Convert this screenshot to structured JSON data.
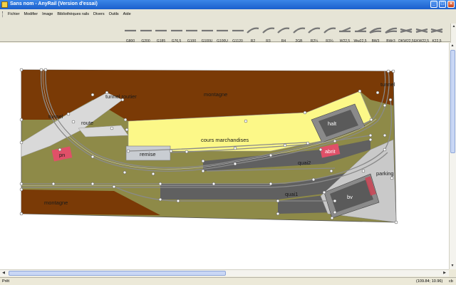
{
  "window": {
    "title": "Sans nom - AnyRail (Version d'essai)",
    "controls": {
      "minimize": "_",
      "maximize": "□",
      "close": "×"
    }
  },
  "menu": [
    "Fichier",
    "Modifier",
    "Image",
    "Bibliothèques rails",
    "Divers",
    "Outils",
    "Aide"
  ],
  "rails": [
    {
      "label": "G800",
      "icon": "straight-track-icon"
    },
    {
      "label": "G200",
      "icon": "straight-track-icon"
    },
    {
      "label": "G185",
      "icon": "straight-track-icon"
    },
    {
      "label": "G76,5",
      "icon": "straight-track-icon"
    },
    {
      "label": "G100",
      "icon": "straight-track-icon"
    },
    {
      "label": "G100U",
      "icon": "straight-track-icon"
    },
    {
      "label": "G100U",
      "icon": "straight-track-icon"
    },
    {
      "label": "G1120",
      "icon": "straight-track-icon"
    },
    {
      "label": "R2",
      "icon": "curved-track-icon"
    },
    {
      "label": "R3",
      "icon": "curved-track-icon"
    },
    {
      "label": "R4",
      "icon": "curved-track-icon"
    },
    {
      "label": "2GB",
      "icon": "curved-track-icon"
    },
    {
      "label": "R2¼",
      "icon": "curved-track-icon"
    },
    {
      "label": "R3¼",
      "icon": "curved-track-icon"
    },
    {
      "label": "W22,5",
      "icon": "switch-icon"
    },
    {
      "label": "Ww22,5",
      "icon": "switch-icon"
    },
    {
      "label": "BW3",
      "icon": "curved-switch-icon"
    },
    {
      "label": "BWr3",
      "icon": "curved-switch-icon"
    },
    {
      "label": "DKW22,5",
      "icon": "crossing-icon"
    },
    {
      "label": "EKW22,5",
      "icon": "crossing-icon"
    },
    {
      "label": "K22,5",
      "icon": "crossing-icon"
    }
  ],
  "layout_labels": {
    "mountain_top": "montagne",
    "mountain_bottom": "montagne",
    "tunnel_left": "tunnel",
    "tunnel_right": "tunnel",
    "road_tunnel": "tunnel routier",
    "road": "route",
    "freight_yard": "cours marchandises",
    "shed": "remise",
    "hall": "halt",
    "shelter": "abrit",
    "platform2": "quai2",
    "platform1": "quai1",
    "parking": "parking",
    "station_building": "bv",
    "crossing_keeper": "pn"
  },
  "colors": {
    "mountain": "#7a3a06",
    "terrain": "#8e8a48",
    "road": "#d9d9d9",
    "freight_yard": "#fcf888",
    "platform": "#606060",
    "building_pink": "#e05068",
    "title_bar": "#1b5fcc"
  },
  "status": {
    "left": "Prêt",
    "coordinates": "(109.84; 10.96)",
    "right": "cb"
  }
}
